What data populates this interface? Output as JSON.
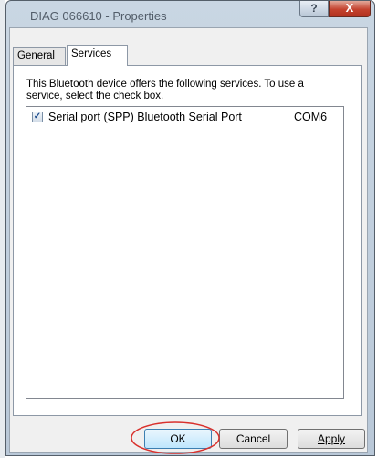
{
  "window": {
    "title": "DIAG 066610 - Properties",
    "help_glyph": "?",
    "close_glyph": "X"
  },
  "tabs": [
    {
      "label": "General",
      "active": false
    },
    {
      "label": "Services",
      "active": true
    }
  ],
  "services_panel": {
    "description": "This Bluetooth device offers the following services. To use a service, select the check box.",
    "services": [
      {
        "checked": true,
        "checkbox_glyph": "✓",
        "name": "Serial port (SPP) Bluetooth Serial Port",
        "port": "COM6"
      }
    ]
  },
  "buttons": {
    "ok": "OK",
    "cancel": "Cancel",
    "apply": "Apply"
  },
  "colors": {
    "highlight_ellipse": "#d9302c",
    "close_button": "#c4422e"
  }
}
